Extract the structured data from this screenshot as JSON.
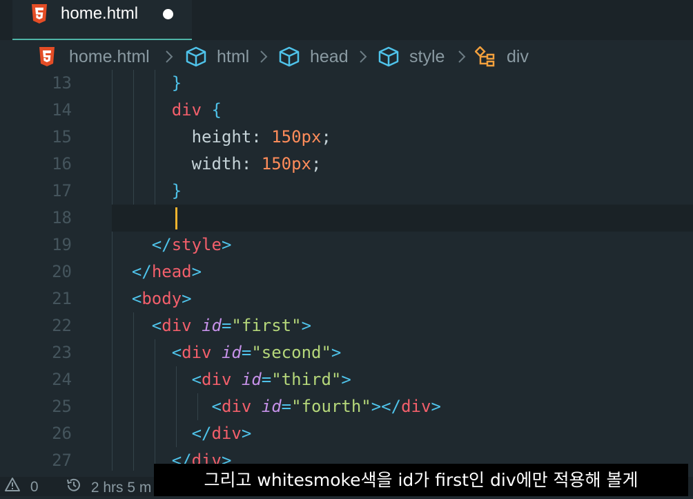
{
  "tab": {
    "title": "home.html",
    "icon": "html5-icon",
    "modified": true
  },
  "breadcrumb": [
    {
      "label": "home.html",
      "icon": "html5-icon"
    },
    {
      "label": "html",
      "icon": "cube-icon"
    },
    {
      "label": "head",
      "icon": "cube-icon"
    },
    {
      "label": "style",
      "icon": "cube-icon"
    },
    {
      "label": "div",
      "icon": "structure-icon"
    }
  ],
  "editor": {
    "lines": [
      {
        "number": "13"
      },
      {
        "number": "14"
      },
      {
        "number": "15"
      },
      {
        "number": "16"
      },
      {
        "number": "17"
      },
      {
        "number": "18"
      },
      {
        "number": "19"
      },
      {
        "number": "20"
      },
      {
        "number": "21"
      },
      {
        "number": "22"
      },
      {
        "number": "23"
      },
      {
        "number": "24"
      },
      {
        "number": "25"
      },
      {
        "number": "26"
      },
      {
        "number": "27"
      }
    ],
    "tokens": {
      "l14_sel": "div",
      "l14_brace": "{",
      "l15_prop": "height",
      "l15_colon": ": ",
      "l15_val": "150px",
      "l15_semi": ";",
      "l16_prop": "width",
      "l16_colon": ": ",
      "l16_val": "150px",
      "l16_semi": ";",
      "brace_close": "}",
      "style": "style",
      "head": "head",
      "body": "body",
      "div": "div",
      "lt": "<",
      "lt_slash": "</",
      "gt": ">",
      "eq": "=",
      "id": "id",
      "first": "\"first\"",
      "second": "\"second\"",
      "third": "\"third\"",
      "fourth": "\"fourth\""
    }
  },
  "statusbar": {
    "problems": "0",
    "time": "2 hrs 5 m"
  },
  "subtitle": "그리고 whitesmoke색을 id가 first인 div에만 적용해 볼게",
  "colors": {
    "background": "#1f292f",
    "tab_underline": "#4fb5a8",
    "caret": "#f2b42e",
    "html5": "#e44d26",
    "cube": "#4fc3ea",
    "structure": "#f2a03d"
  }
}
